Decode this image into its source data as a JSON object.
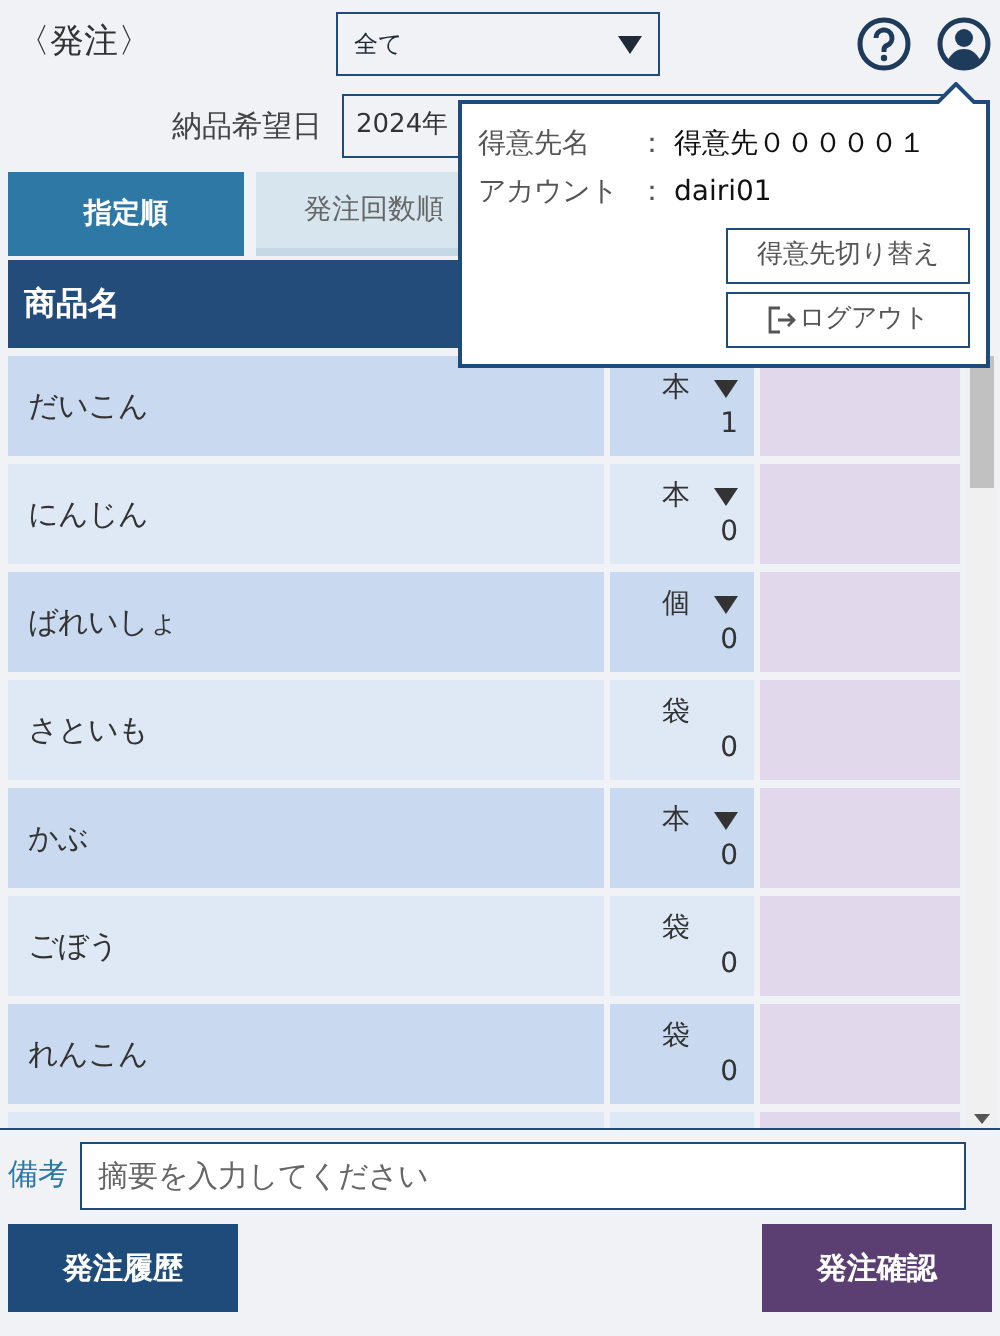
{
  "header": {
    "back": "〈発注〉",
    "filter": {
      "value": "全て"
    }
  },
  "delivery_date": {
    "label": "納品希望日",
    "value": "2024年"
  },
  "tabs": [
    {
      "label": "指定順",
      "selected": true
    },
    {
      "label": "発注回数順",
      "selected": false
    }
  ],
  "table": {
    "columns": [
      "商品名"
    ],
    "rows": [
      {
        "name": "だいこん",
        "unit": "本",
        "unit_dropdown": true,
        "quantity": "1"
      },
      {
        "name": "にんじん",
        "unit": "本",
        "unit_dropdown": true,
        "quantity": "0"
      },
      {
        "name": "ばれいしょ",
        "unit": "個",
        "unit_dropdown": true,
        "quantity": "0"
      },
      {
        "name": "さといも",
        "unit": "袋",
        "unit_dropdown": false,
        "quantity": "0"
      },
      {
        "name": "かぶ",
        "unit": "本",
        "unit_dropdown": true,
        "quantity": "0"
      },
      {
        "name": "ごぼう",
        "unit": "袋",
        "unit_dropdown": false,
        "quantity": "0"
      },
      {
        "name": "れんこん",
        "unit": "袋",
        "unit_dropdown": false,
        "quantity": "0"
      }
    ]
  },
  "account_popup": {
    "fields": [
      {
        "label": "得意先名",
        "value": "得意先０００００１"
      },
      {
        "label": "アカウント",
        "value": "dairi01"
      }
    ],
    "separator": "：",
    "buttons": [
      {
        "label": "得意先切り替え",
        "kind": "plain"
      },
      {
        "label": "ログアウト",
        "kind": "logout"
      }
    ]
  },
  "remarks": {
    "label": "備考",
    "placeholder": "摘要を入力してください"
  },
  "footer_buttons": [
    "発注履歴",
    "発注確認"
  ]
}
